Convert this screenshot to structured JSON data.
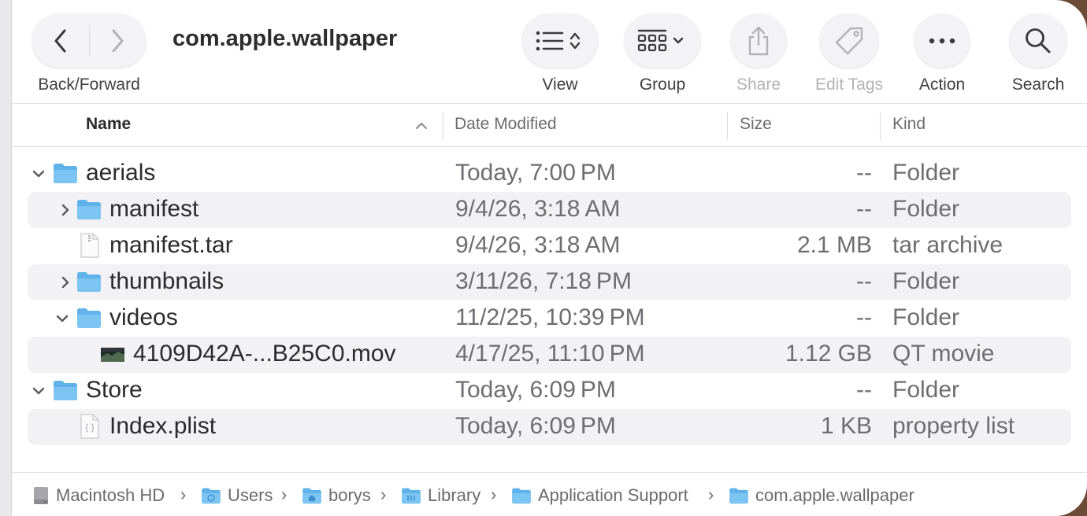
{
  "window": {
    "title": "com.apple.wallpaper"
  },
  "toolbar": {
    "back_forward_label": "Back/Forward",
    "view_label": "View",
    "group_label": "Group",
    "share_label": "Share",
    "edit_tags_label": "Edit Tags",
    "action_label": "Action",
    "search_label": "Search"
  },
  "columns": {
    "name": "Name",
    "date": "Date Modified",
    "size": "Size",
    "kind": "Kind"
  },
  "rows": [
    {
      "name": "aerials",
      "date": "Today, 7:00 PM",
      "size": "--",
      "kind": "Folder",
      "icon": "folder-icon",
      "expanded": true
    },
    {
      "name": "manifest",
      "date": "9/4/26, 3:18 AM",
      "size": "--",
      "kind": "Folder",
      "icon": "folder-icon",
      "expanded": false
    },
    {
      "name": "manifest.tar",
      "date": "9/4/26, 3:18 AM",
      "size": "2.1 MB",
      "kind": "tar archive",
      "icon": "archive-file-icon"
    },
    {
      "name": "thumbnails",
      "date": "3/11/26, 7:18 PM",
      "size": "--",
      "kind": "Folder",
      "icon": "folder-icon",
      "expanded": false
    },
    {
      "name": "videos",
      "date": "11/2/25, 10:39 PM",
      "size": "--",
      "kind": "Folder",
      "icon": "folder-icon",
      "expanded": true
    },
    {
      "name": "4109D42A-...B25C0.mov",
      "date": "4/17/25, 11:10 PM",
      "size": "1.12 GB",
      "kind": "QT movie",
      "icon": "movie-thumbnail-icon"
    },
    {
      "name": "Store",
      "date": "Today, 6:09 PM",
      "size": "--",
      "kind": "Folder",
      "icon": "folder-icon",
      "expanded": true
    },
    {
      "name": "Index.plist",
      "date": "Today, 6:09 PM",
      "size": "1 KB",
      "kind": "property list",
      "icon": "plist-file-icon"
    }
  ],
  "pathbar": [
    "Macintosh HD",
    "Users",
    "borys",
    "Library",
    "Application Support",
    "com.apple.wallpaper"
  ],
  "colors": {
    "folder": "#5fb3ea",
    "row_alt": "#f2f2f4",
    "text": "#2b2b2d",
    "secondary_text": "#6e6e72"
  }
}
